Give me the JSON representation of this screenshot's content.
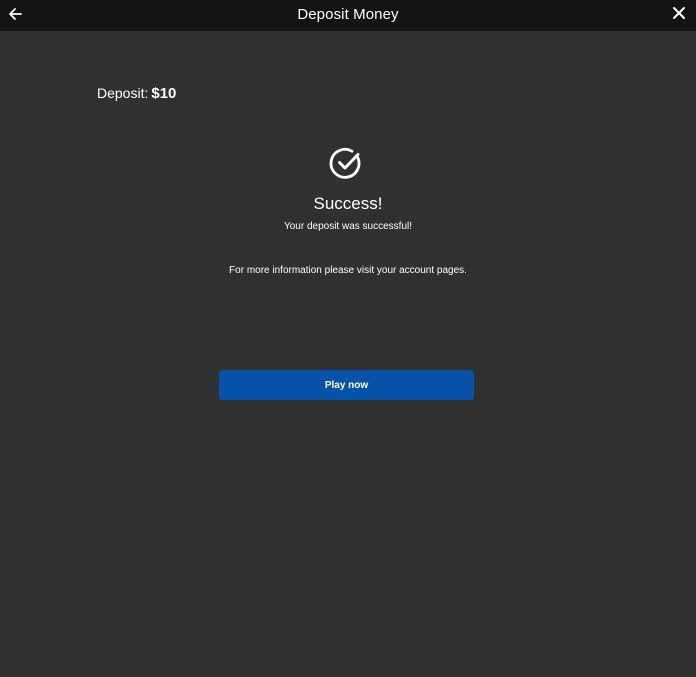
{
  "header": {
    "title": "Deposit Money",
    "back_icon": "arrow-left-icon",
    "close_icon": "close-icon"
  },
  "deposit": {
    "label": "Deposit:",
    "amount": "$10"
  },
  "result": {
    "icon": "check-circle-icon",
    "title": "Success!",
    "message": "Your deposit was successful!",
    "info": "For more information please visit your account pages."
  },
  "actions": {
    "play_label": "Play now"
  },
  "colors": {
    "background": "#303030",
    "header": "#141414",
    "primary_button": "#0652a8",
    "text": "#ffffff"
  }
}
